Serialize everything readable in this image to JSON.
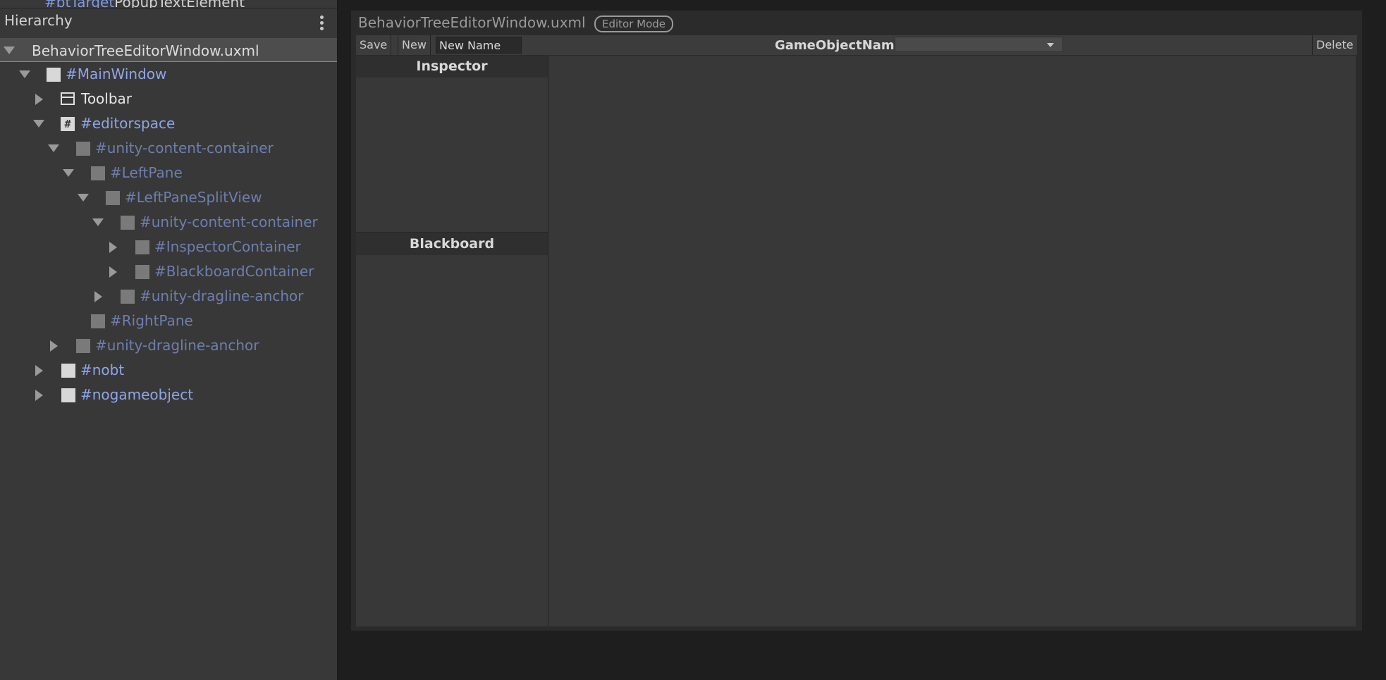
{
  "hierarchy": {
    "cutoff_selector": "#btTarget",
    "cutoff_name": "PopupTextElement",
    "title": "Hierarchy",
    "root_label": "BehaviorTreeEditorWindow.uxml",
    "items": [
      {
        "label": "#MainWindow"
      },
      {
        "label": "Toolbar"
      },
      {
        "label": "#editorspace"
      },
      {
        "label": "#unity-content-container"
      },
      {
        "label": "#LeftPane"
      },
      {
        "label": "#LeftPaneSplitView"
      },
      {
        "label": "#unity-content-container"
      },
      {
        "label": "#InspectorContainer"
      },
      {
        "label": "#BlackboardContainer"
      },
      {
        "label": "#unity-dragline-anchor"
      },
      {
        "label": "#RightPane"
      },
      {
        "label": "#unity-dragline-anchor"
      },
      {
        "label": "#nobt"
      },
      {
        "label": "#nogameobject"
      }
    ]
  },
  "editor": {
    "title": "BehaviorTreeEditorWindow.uxml",
    "mode_badge": "Editor Mode",
    "toolbar": {
      "save": "Save",
      "new": "New",
      "name_value": "New Name",
      "gameobject_label": "GameObjectName",
      "gameobject_value": "",
      "delete": "Delete"
    },
    "inspector_title": "Inspector",
    "blackboard_title": "Blackboard"
  },
  "colors": {
    "selector_blue": "#8ea6e8",
    "dimmed_blue": "#6d7fae",
    "panel_bg": "#383838"
  }
}
